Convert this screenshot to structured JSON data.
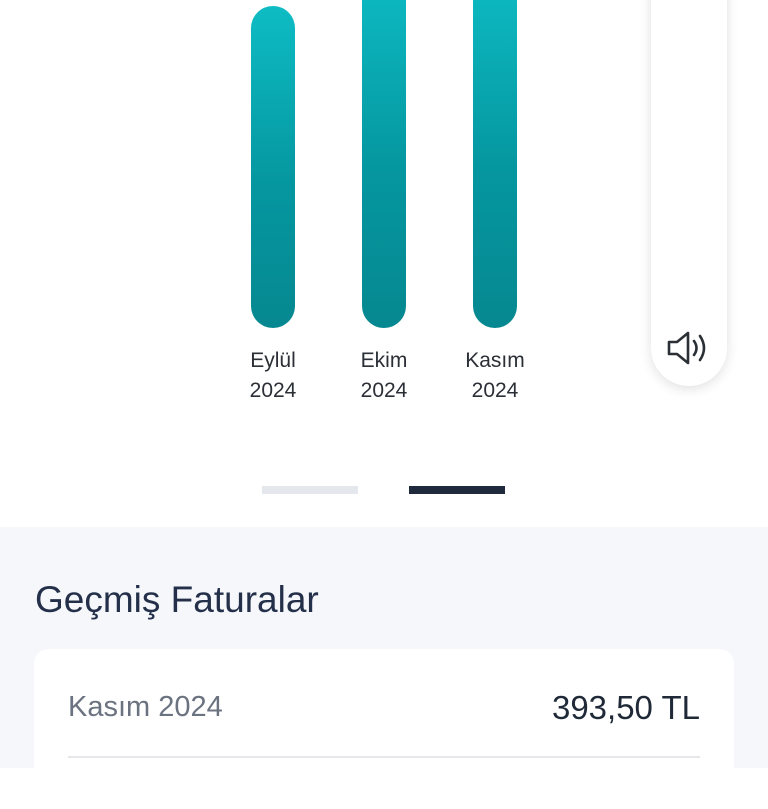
{
  "chart": {
    "bars": [
      {
        "month": "Eylül",
        "year": "2024",
        "top_clipped": false
      },
      {
        "month": "Ekim",
        "year": "2024",
        "top_clipped": true
      },
      {
        "month": "Kasım",
        "year": "2024",
        "top_clipped": true
      }
    ]
  },
  "side_panel": {
    "icon": "speaker-icon"
  },
  "pager": {
    "count": 2,
    "active_index": 1
  },
  "colors": {
    "bar_top": "#0ebcc4",
    "bar_bottom": "#068890",
    "pager_active": "#1f2a3d",
    "pager_inactive": "#e4e7ec",
    "section_bg": "#f5f7fa",
    "title_text": "#24304a"
  },
  "past_invoices": {
    "title": "Geçmiş Faturalar",
    "items": [
      {
        "period": "Kasım 2024",
        "amount": "393,50 TL"
      }
    ]
  }
}
